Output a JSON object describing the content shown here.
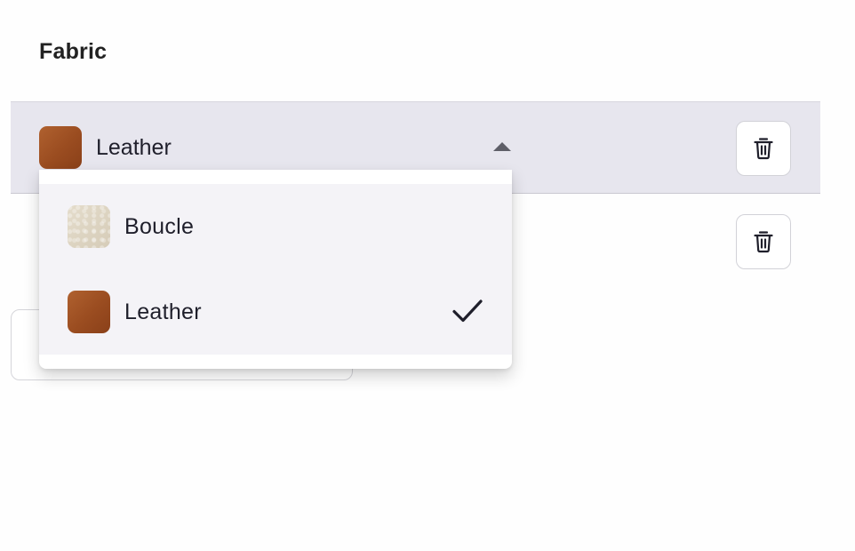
{
  "section": {
    "title": "Fabric"
  },
  "row1": {
    "selected_label": "Leather",
    "selected_swatch": "leather"
  },
  "dropdown": {
    "options": [
      {
        "label": "Boucle",
        "swatch": "boucle",
        "selected": false
      },
      {
        "label": "Leather",
        "swatch": "leather",
        "selected": true
      }
    ]
  },
  "icons": {
    "delete": "trash-icon",
    "caret": "caret-up-icon",
    "check": "checkmark-icon"
  },
  "colors": {
    "active_row_bg": "#e7e6ee",
    "dropdown_option_bg": "#f4f3f7",
    "leather": "#a0522d",
    "boucle": "#ddd3c1",
    "text": "#1f1f2b"
  }
}
